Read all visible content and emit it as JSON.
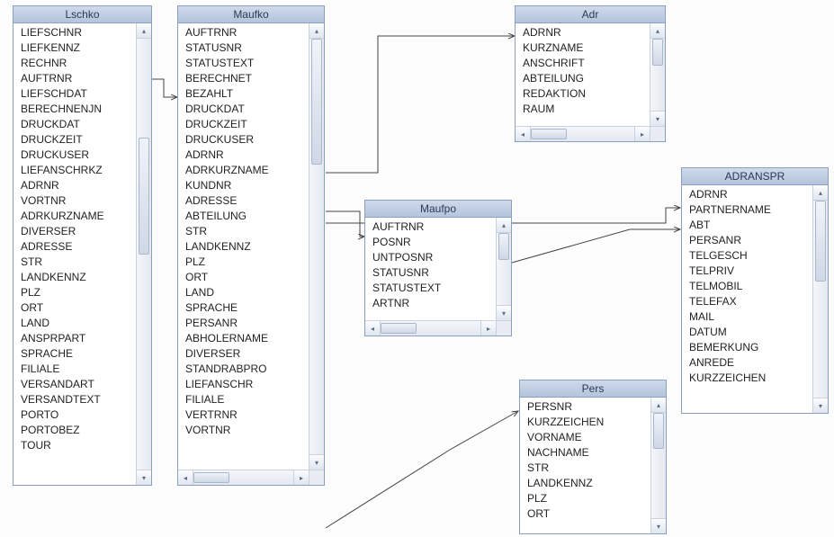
{
  "tables": {
    "lschko": {
      "title": "Lschko",
      "fields": [
        "LIEFSCHNR",
        "LIEFKENNZ",
        "RECHNR",
        "AUFTRNR",
        "LIEFSCHDAT",
        "BERECHNENJN",
        "DRUCKDAT",
        "DRUCKZEIT",
        "DRUCKUSER",
        "LIEFANSCHRKZ",
        "ADRNR",
        "VORTNR",
        "ADRKURZNAME",
        "DIVERSER",
        "ADRESSE",
        "STR",
        "LANDKENNZ",
        "PLZ",
        "ORT",
        "LAND",
        "ANSPRPART",
        "SPRACHE",
        "FILIALE",
        "VERSANDART",
        "VERSANDTEXT",
        "PORTO",
        "PORTOBEZ",
        "TOUR"
      ]
    },
    "maufko": {
      "title": "Maufko",
      "fields": [
        "AUFTRNR",
        "STATUSNR",
        "STATUSTEXT",
        "BERECHNET",
        "BEZAHLT",
        "DRUCKDAT",
        "DRUCKZEIT",
        "DRUCKUSER",
        "ADRNR",
        "ADRKURZNAME",
        "KUNDNR",
        "ADRESSE",
        "ABTEILUNG",
        "STR",
        "LANDKENNZ",
        "PLZ",
        "ORT",
        "LAND",
        "SPRACHE",
        "PERSANR",
        "ABHOLERNAME",
        "DIVERSER",
        "STANDRABPRO",
        "LIEFANSCHR",
        "FILIALE",
        "VERTRNR",
        "VORTNR"
      ]
    },
    "adr": {
      "title": "Adr",
      "fields": [
        "ADRNR",
        "KURZNAME",
        "ANSCHRIFT",
        "ABTEILUNG",
        "REDAKTION",
        "RAUM"
      ]
    },
    "maufpo": {
      "title": "Maufpo",
      "fields": [
        "AUFTRNR",
        "POSNR",
        "UNTPOSNR",
        "STATUSNR",
        "STATUSTEXT",
        "ARTNR"
      ]
    },
    "pers": {
      "title": "Pers",
      "fields": [
        "PERSNR",
        "KURZZEICHEN",
        "VORNAME",
        "NACHNAME",
        "STR",
        "LANDKENNZ",
        "PLZ",
        "ORT"
      ]
    },
    "adranspr": {
      "title": "ADRANSPR",
      "fields": [
        "ADRNR",
        "PARTNERNAME",
        "ABT",
        "PERSANR",
        "TELGESCH",
        "TELPRIV",
        "TELMOBIL",
        "TELEFAX",
        "MAIL",
        "DATUM",
        "BEMERKUNG",
        "ANREDE",
        "KURZZEICHEN"
      ]
    }
  },
  "connections": [
    {
      "from": "lschko",
      "to": "maufko"
    },
    {
      "from": "maufko",
      "to": "adr"
    },
    {
      "from": "maufko",
      "to": "maufpo"
    },
    {
      "from": "maufko",
      "to": "adranspr"
    },
    {
      "from": "maufko",
      "to": "pers"
    },
    {
      "from": "maufpo",
      "to": "adranspr"
    }
  ]
}
